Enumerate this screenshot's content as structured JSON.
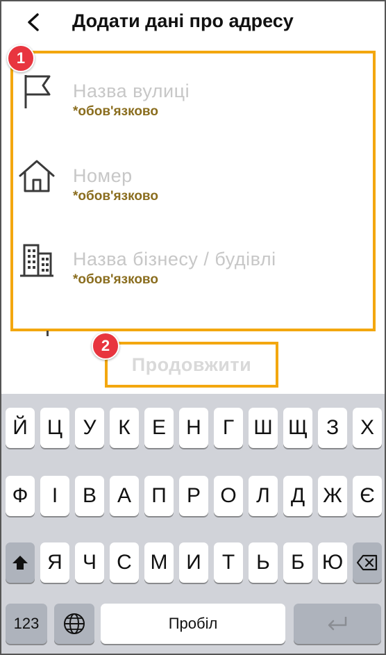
{
  "header": {
    "title": "Додати дані про адресу",
    "back_icon": "chevron-left-icon"
  },
  "fields": [
    {
      "icon": "flag-icon",
      "placeholder": "Назва вулиці",
      "required": "*обов'язково"
    },
    {
      "icon": "house-icon",
      "placeholder": "Номер",
      "required": "*обов'язково"
    },
    {
      "icon": "building-icon",
      "placeholder": "Назва бізнесу / будівлі",
      "required": "*обов'язково"
    }
  ],
  "annotations": {
    "badge1": "1",
    "badge2": "2",
    "highlight_color": "#f3a70f",
    "badge_color": "#e8353f"
  },
  "continue_label": "Продовжити",
  "keyboard": {
    "row1": [
      "Й",
      "Ц",
      "У",
      "К",
      "Е",
      "Н",
      "Г",
      "Ш",
      "Щ",
      "З",
      "Х"
    ],
    "row2": [
      "Ф",
      "І",
      "В",
      "А",
      "П",
      "Р",
      "О",
      "Л",
      "Д",
      "Ж",
      "Є"
    ],
    "row3": [
      "Я",
      "Ч",
      "С",
      "М",
      "И",
      "Т",
      "Ь",
      "Б",
      "Ю"
    ],
    "shift_icon": "shift-icon",
    "delete_icon": "backspace-icon",
    "numbers_label": "123",
    "globe_icon": "globe-icon",
    "space_label": "Пробіл",
    "return_icon": "return-icon"
  }
}
